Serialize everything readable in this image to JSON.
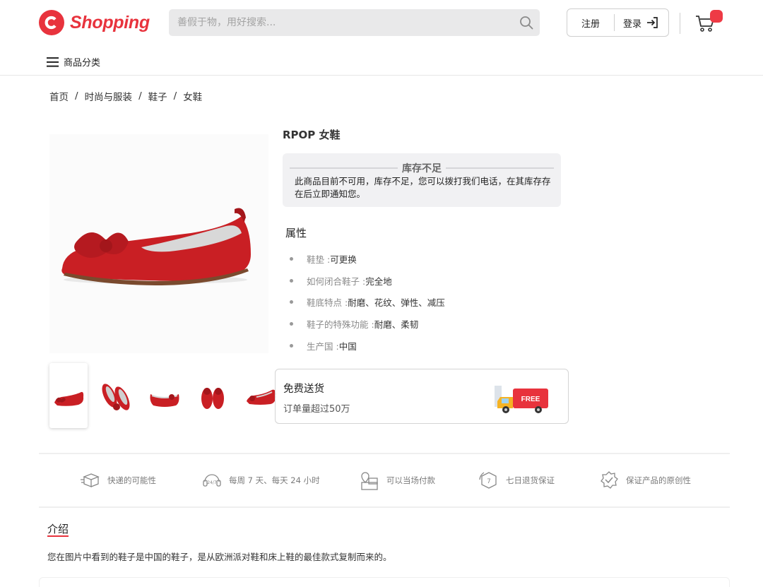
{
  "header": {
    "logo_letter": "C",
    "logo_text": "Shopping",
    "search_placeholder": "善假于物，用好搜索...",
    "register_label": "注册",
    "login_label": "登录",
    "categories_label": "商品分类",
    "brand_color": "#e8333d"
  },
  "breadcrumb": [
    "首页",
    "时尚与服装",
    "鞋子",
    "女鞋"
  ],
  "product": {
    "title": "RPOP 女鞋",
    "stock_status": "库存不足",
    "stock_message": "此商品目前不可用，库存不足，您可以拨打我们电话，在其库存存在后立即通知您。",
    "attributes_title": "属性",
    "attributes": [
      {
        "key": "鞋垫 :",
        "value": "可更换"
      },
      {
        "key": "如何闭合鞋子 :",
        "value": "完全地"
      },
      {
        "key": "鞋底特点 :",
        "value": "耐磨、花纹、弹性、减压"
      },
      {
        "key": "鞋子的特殊功能 :",
        "value": "耐磨、柔韧"
      },
      {
        "key": "生产国 :",
        "value": "中国"
      }
    ],
    "thumbnail_count": 5,
    "shipping": {
      "title": "免费送货",
      "subtitle": "订单量超过50万",
      "badge": "FREE"
    }
  },
  "features": [
    {
      "icon": "delivery-box-icon",
      "label": "快递的可能性"
    },
    {
      "icon": "support-24-7-icon",
      "label": "每周 7 天、每天 24 小时"
    },
    {
      "icon": "pay-on-delivery-icon",
      "label": "可以当场付款"
    },
    {
      "icon": "seven-day-return-icon",
      "label": "七日退货保证"
    },
    {
      "icon": "originality-badge-icon",
      "label": "保证产品的原创性"
    }
  ],
  "intro": {
    "title": "介绍",
    "text": "您在图片中看到的鞋子是中国的鞋子，是从欧洲派对鞋和床上鞋的最佳款式复制而来的。"
  }
}
